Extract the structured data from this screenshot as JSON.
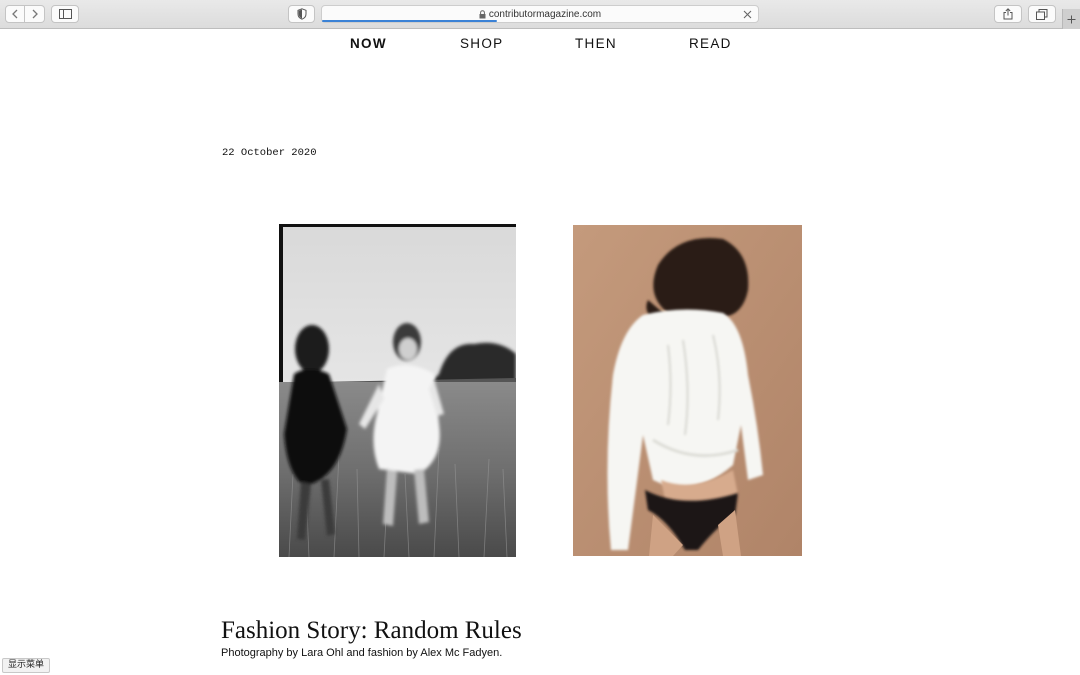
{
  "browser": {
    "url": "contributormagazine.com",
    "load_progress": 0.4
  },
  "nav": {
    "items": [
      {
        "label": "NOW",
        "active": true
      },
      {
        "label": "SHOP",
        "active": false
      },
      {
        "label": "THEN",
        "active": false
      },
      {
        "label": "READ",
        "active": false
      }
    ]
  },
  "article": {
    "date": "22 October 2020",
    "title": "Fashion Story: Random Rules",
    "credits": "Photography by Lara Ohl and fashion by Alex Mc Fadyen.",
    "images": [
      {
        "description": "black-and-white-photo-two-women-running-in-field"
      },
      {
        "description": "color-photo-woman-in-white-ruffled-shirt"
      }
    ]
  },
  "overlay": {
    "show_menu_label": "显示菜单"
  },
  "colors": {
    "page_background": "#ffffff",
    "text": "#111111",
    "load_bar": "#3b82d6",
    "photo_backdrop": "#b98f72"
  }
}
